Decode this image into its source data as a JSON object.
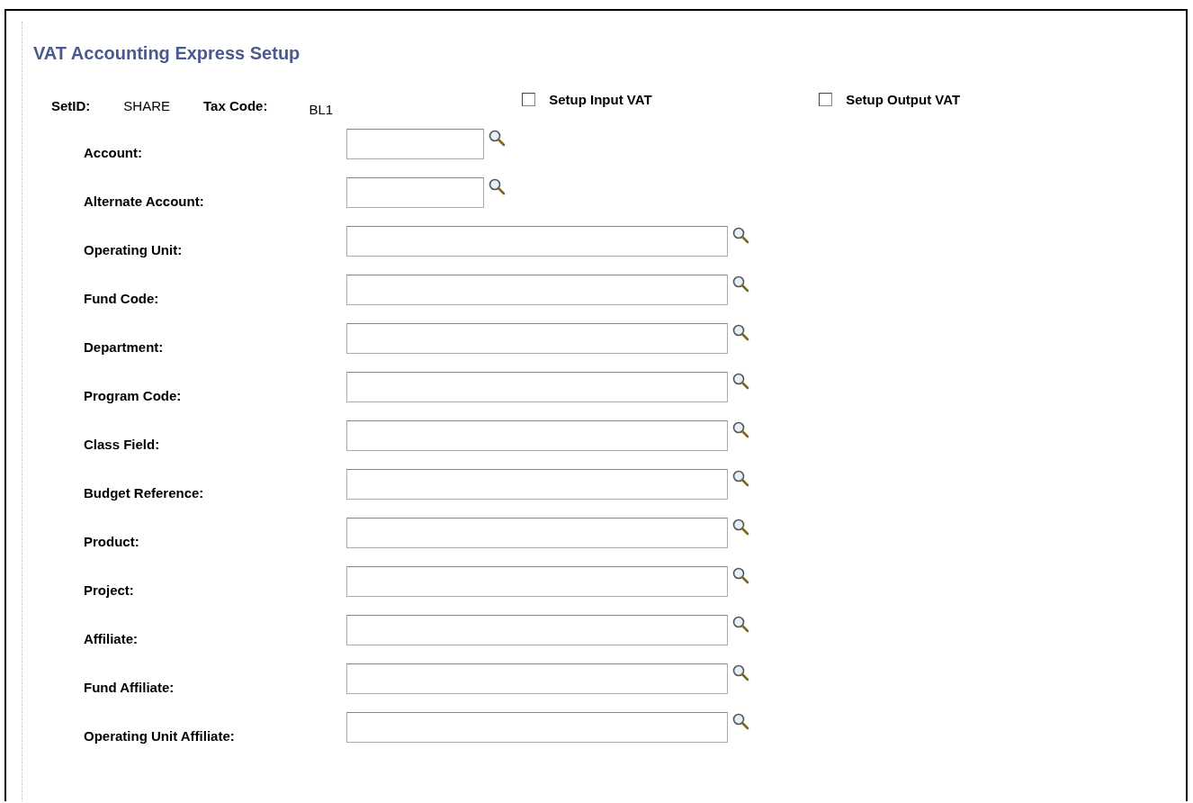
{
  "page": {
    "title": "VAT Accounting Express Setup"
  },
  "header": {
    "setid_label": "SetID:",
    "setid_value": "SHARE",
    "tax_code_label": "Tax Code:",
    "tax_code_value": "BL1"
  },
  "options": [
    {
      "label": "Setup Input VAT",
      "checked": false
    },
    {
      "label": "Setup Output VAT",
      "checked": false
    }
  ],
  "fields": [
    {
      "label": "Account:",
      "kind": "short"
    },
    {
      "label": "Alternate Account:",
      "kind": "short"
    },
    {
      "label": "Operating Unit:",
      "kind": "long"
    },
    {
      "label": "Fund Code:",
      "kind": "long"
    },
    {
      "label": "Department:",
      "kind": "long"
    },
    {
      "label": "Program Code:",
      "kind": "long"
    },
    {
      "label": "Class Field:",
      "kind": "long"
    },
    {
      "label": "Budget Reference:",
      "kind": "long"
    },
    {
      "label": "Product:",
      "kind": "long"
    },
    {
      "label": "Project:",
      "kind": "long"
    },
    {
      "label": "Affiliate:",
      "kind": "long"
    },
    {
      "label": "Fund Affiliate:",
      "kind": "long"
    },
    {
      "label": "Operating Unit Affiliate:",
      "kind": "long"
    }
  ]
}
